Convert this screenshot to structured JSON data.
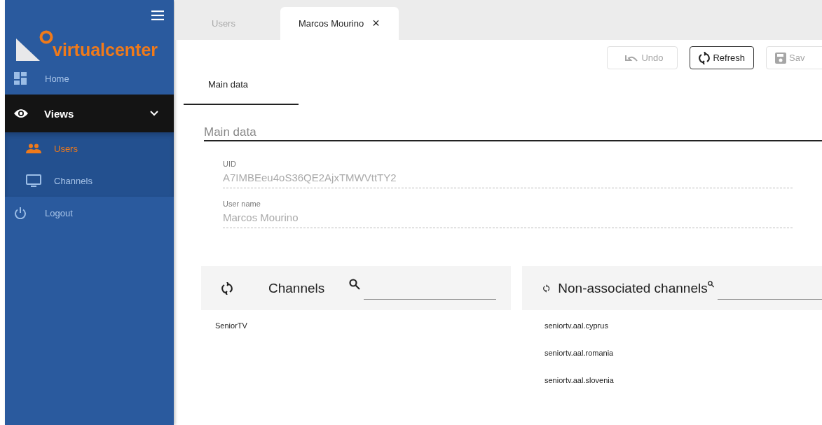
{
  "sidebar": {
    "logo": "virtualcenter",
    "items": [
      {
        "kind": "nav",
        "label": "Home",
        "selected": false
      },
      {
        "kind": "group",
        "label": "Views",
        "expanded": true,
        "children": [
          {
            "label": "Users",
            "selected": true
          },
          {
            "label": "Channels",
            "selected": false
          }
        ]
      },
      {
        "kind": "nav",
        "label": "Logout",
        "selected": false
      }
    ]
  },
  "tabs": [
    {
      "label": "Users",
      "selected": false
    },
    {
      "label": "Marcos Mourino",
      "selected": true,
      "close": "×"
    }
  ],
  "toolbar": [
    {
      "label": "Undo",
      "disabled": true
    },
    {
      "label": "Refresh",
      "disabled": false
    },
    {
      "label": "Sav",
      "disabled": true
    }
  ],
  "subtabs": [
    {
      "label": "Main data",
      "selected": true
    }
  ],
  "section_title": "Main data",
  "fields": [
    {
      "label": "UID",
      "value": "A7IMBEeu4oS36QE2AjxTMWVttTY2"
    },
    {
      "label": "User name",
      "value": "Marcos Mourino"
    }
  ],
  "panels": [
    {
      "title": "Channels",
      "items": [
        "SeniorTV"
      ]
    },
    {
      "title": "Non-associated channels",
      "items": [
        "seniortv.aal.cyprus",
        "seniortv.aal.romania",
        "seniortv.aal.slovenia"
      ]
    }
  ]
}
